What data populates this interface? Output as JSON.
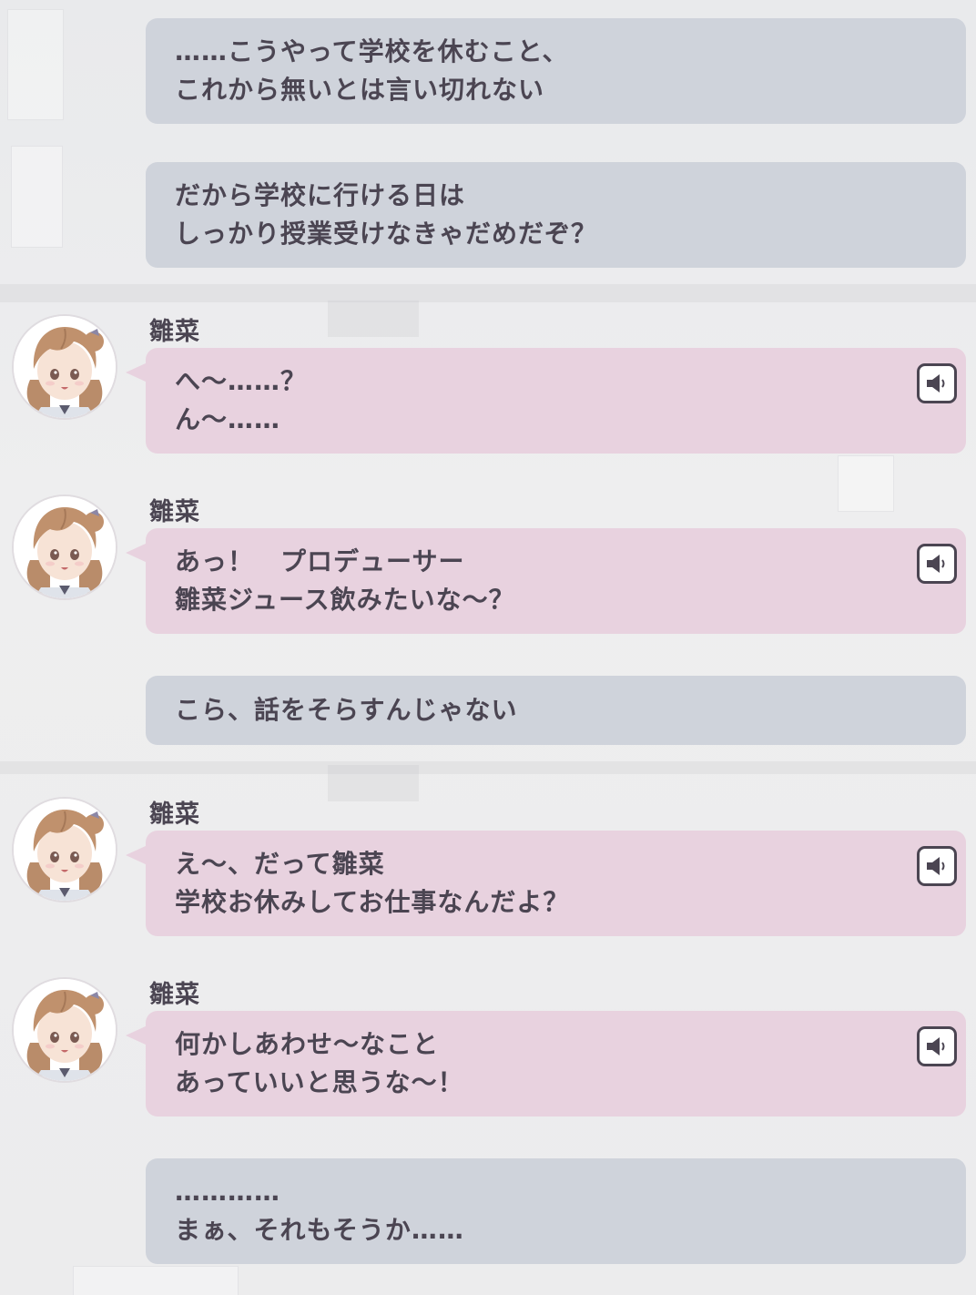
{
  "messages": [
    {
      "type": "narration",
      "lines": [
        "……こうやって学校を休むこと、",
        "これから無いとは言い切れない"
      ]
    },
    {
      "type": "narration",
      "lines": [
        "だから学校に行ける日は",
        "しっかり授業受けなきゃだめだぞ？"
      ]
    },
    {
      "type": "character",
      "speaker": "雛菜",
      "lines": [
        "へ～……？",
        "ん～……"
      ],
      "voice_icon": "speaker-icon"
    },
    {
      "type": "character",
      "speaker": "雛菜",
      "lines": [
        "あっ！　プロデューサー",
        "雛菜ジュース飲みたいな～？"
      ],
      "voice_icon": "speaker-icon"
    },
    {
      "type": "narration",
      "lines": [
        "こら、話をそらすんじゃない"
      ]
    },
    {
      "type": "character",
      "speaker": "雛菜",
      "lines": [
        "え～、だって雛菜",
        "学校お休みしてお仕事なんだよ？"
      ],
      "voice_icon": "speaker-icon"
    },
    {
      "type": "character",
      "speaker": "雛菜",
      "lines": [
        "何かしあわせ～なこと",
        "あっていいと思うな～！"
      ],
      "voice_icon": "speaker-icon"
    },
    {
      "type": "narration",
      "lines": [
        "…………",
        "まぁ、それもそうか……"
      ]
    }
  ],
  "colors": {
    "narration_bubble": "#cfd3db",
    "character_bubble": "#e8d2df",
    "text": "#4b4552"
  }
}
